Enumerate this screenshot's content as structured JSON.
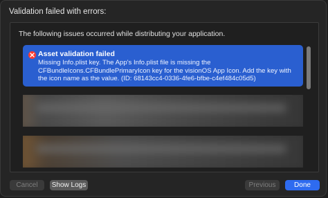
{
  "window": {
    "title": "Validation failed with errors:"
  },
  "panel": {
    "intro": "The following issues occurred while distributing your application."
  },
  "issues": [
    {
      "title": "Asset validation failed",
      "message": "Missing Info.plist key. The App's Info.plist file is missing the CFBundleIcons.CFBundlePrimaryIcon key for the visionOS App Icon. Add the key with the icon name as the value. (ID: 68143cc4-0336-4fe6-bfbe-c4ef484c05d5)",
      "icon": "error-x-icon",
      "color": "#2a5fd0"
    }
  ],
  "buttons": {
    "cancel": "Cancel",
    "show_logs": "Show Logs",
    "previous": "Previous",
    "done": "Done"
  },
  "colors": {
    "accent": "#2e6bf0",
    "error": "#ff3b30"
  }
}
